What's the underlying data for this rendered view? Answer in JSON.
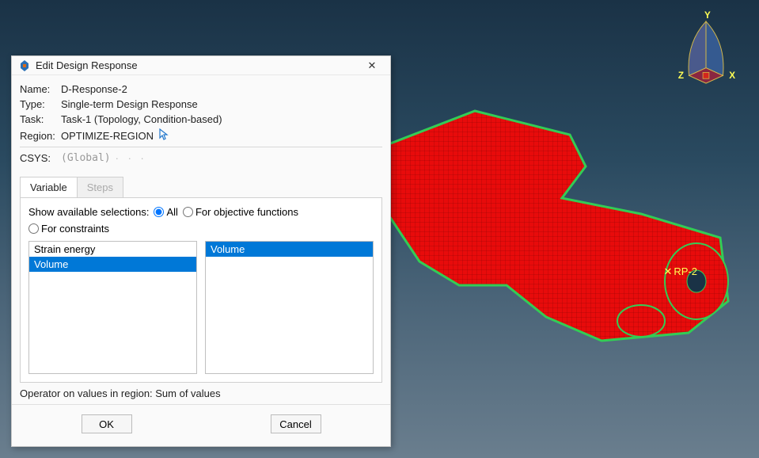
{
  "triad": {
    "x": "X",
    "y": "Y",
    "z": "Z"
  },
  "viewport": {
    "reference_point_label": "RP-2"
  },
  "dialog": {
    "title": "Edit Design Response",
    "fields": {
      "name_label": "Name:",
      "name_value": "D-Response-2",
      "type_label": "Type:",
      "type_value": "Single-term Design Response",
      "task_label": "Task:",
      "task_value": "Task-1 (Topology, Condition-based)",
      "region_label": "Region:",
      "region_value": "OPTIMIZE-REGION",
      "csys_label": "CSYS:",
      "csys_value": "(Global)"
    },
    "tabs": {
      "variable": "Variable",
      "steps": "Steps"
    },
    "filter": {
      "label": "Show available selections:",
      "options": {
        "all": "All",
        "objective": "For objective functions",
        "constraints": "For constraints"
      },
      "selected": "all"
    },
    "available_list": [
      {
        "label": "Strain energy",
        "selected": false
      },
      {
        "label": "Volume",
        "selected": true
      }
    ],
    "chosen_list": [
      {
        "label": "Volume",
        "selected": true
      }
    ],
    "operator_text": "Operator on values in region: Sum of values",
    "buttons": {
      "ok": "OK",
      "cancel": "Cancel"
    }
  }
}
